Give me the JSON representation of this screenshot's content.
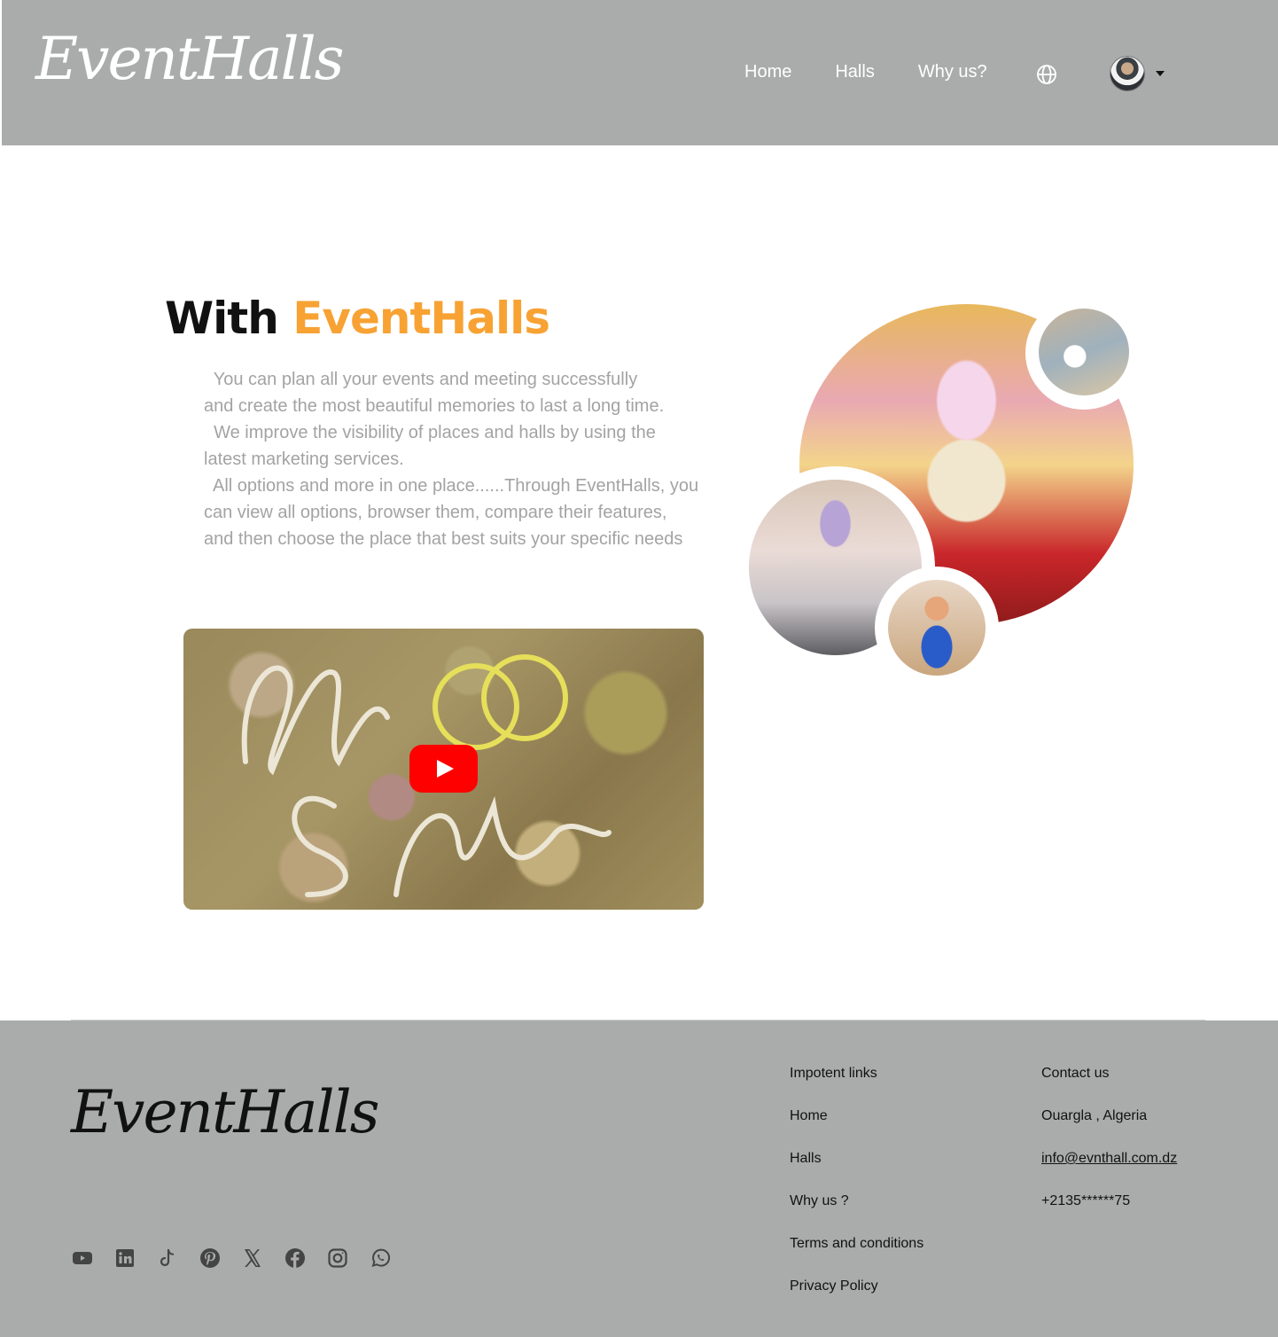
{
  "header": {
    "logo": "EventHalls",
    "nav": [
      {
        "label": "Home"
      },
      {
        "label": "Halls"
      },
      {
        "label": "Why us?"
      }
    ],
    "icons": {
      "language": "globe-icon",
      "user_menu": "caret-down-icon"
    }
  },
  "hero": {
    "title_prefix": "With",
    "title_brand": "EventHalls",
    "lines": [
      "  You can plan all your events and meeting successfully",
      "and create the most beautiful memories to last a long time.",
      "  We improve the visibility of places and halls by using the",
      "latest marketing services.",
      "  All options and more in one place......Through EventHalls, you",
      "can view all options, browser them, compare their features,",
      "and then choose the place that best suits your specific needs"
    ]
  },
  "video": {
    "play_icon": "youtube-play-icon"
  },
  "footer": {
    "logo": "EventHalls",
    "links_title": "Impotent links",
    "links": [
      "Home",
      "Halls",
      "Why us ?",
      "Terms and conditions",
      "Privacy Policy"
    ],
    "contact_title": "Contact us",
    "contact": {
      "location": "Ouargla , Algeria",
      "email": "info@evnthall.com.dz",
      "phone": "+2135******75"
    },
    "socials": [
      "youtube-icon",
      "linkedin-icon",
      "tiktok-icon",
      "pinterest-icon",
      "x-icon",
      "facebook-icon",
      "instagram-icon",
      "whatsapp-icon"
    ]
  },
  "colors": {
    "header_bg": "#aaacab",
    "brand_orange": "#f7a233",
    "body_text": "#a3a3a3",
    "play_red": "#ff0000"
  }
}
